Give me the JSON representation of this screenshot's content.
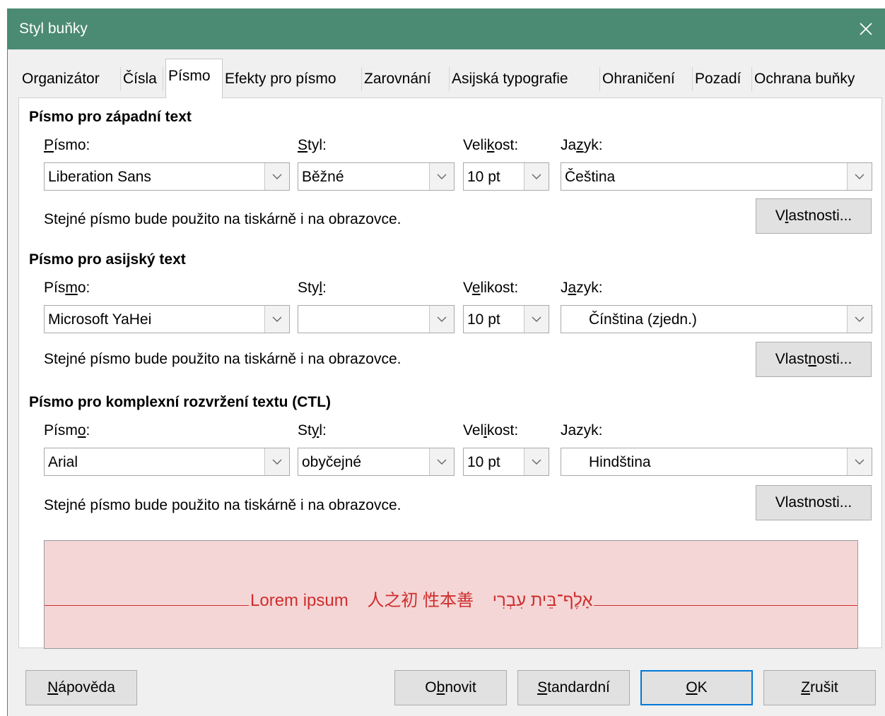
{
  "window": {
    "title": "Styl buňky"
  },
  "tabs": [
    "Organizátor",
    "Čísla",
    "Písmo",
    "Efekty pro písmo",
    "Zarovnání",
    "Asijská typografie",
    "Ohraničení",
    "Pozadí",
    "Ochrana buňky"
  ],
  "active_tab": "Písmo",
  "western": {
    "title": "Písmo pro západní text",
    "font_label": {
      "pre": "",
      "key": "P",
      "post": "ísmo:"
    },
    "style_label": {
      "pre": "",
      "key": "S",
      "post": "tyl:"
    },
    "size_label": {
      "pre": "Veli",
      "key": "k",
      "post": "ost:"
    },
    "lang_label": {
      "pre": "Ja",
      "key": "z",
      "post": "yk:"
    },
    "font_value": "Liberation Sans",
    "style_value": "Běžné",
    "size_value": "10 pt",
    "lang_value": "Čeština",
    "info": "Stejné písmo bude použito na tiskárně i na obrazovce.",
    "props": {
      "pre": "V",
      "key": "l",
      "post": "astnosti..."
    }
  },
  "asian": {
    "title": "Písmo pro asijský text",
    "font_label": {
      "pre": "Pís",
      "key": "m",
      "post": "o:"
    },
    "style_label": {
      "pre": "Sty",
      "key": "l",
      "post": ":"
    },
    "size_label": {
      "pre": "V",
      "key": "e",
      "post": "likost:"
    },
    "lang_label": {
      "pre": "J",
      "key": "a",
      "post": "zyk:"
    },
    "font_value": "Microsoft YaHei",
    "style_value": "",
    "size_value": "10 pt",
    "lang_value": "Čínština (zjedn.)",
    "info": "Stejné písmo bude použito na tiskárně i na obrazovce.",
    "props": {
      "pre": "Vlast",
      "key": "n",
      "post": "osti..."
    }
  },
  "ctl": {
    "title": "Písmo pro komplexní rozvržení textu (CTL)",
    "font_label": {
      "pre": "Písm",
      "key": "o",
      "post": ":"
    },
    "style_label": {
      "pre": "St",
      "key": "y",
      "post": "l:"
    },
    "size_label": {
      "pre": "Vel",
      "key": "i",
      "post": "kost:"
    },
    "lang_label": {
      "pre": "Jazyk:",
      "key": "",
      "post": ""
    },
    "font_value": "Arial",
    "style_value": "obyčejné",
    "size_value": "10 pt",
    "lang_value": "Hindština",
    "info": "Stejné písmo bude použito na tiskárně i na obrazovce.",
    "props": {
      "pre": "Vlastnosti...",
      "key": "",
      "post": ""
    }
  },
  "preview": {
    "western": "Lorem ipsum",
    "asian": "人之初 性本善",
    "ctl": "אָלֶף־בֵּית עִבְרִי"
  },
  "footer": {
    "help": {
      "pre": "",
      "key": "N",
      "post": "ápověda"
    },
    "reset": {
      "pre": "O",
      "key": "b",
      "post": "novit"
    },
    "standard": {
      "pre": "",
      "key": "S",
      "post": "tandardní"
    },
    "ok": {
      "pre": "",
      "key": "O",
      "post": "K"
    },
    "cancel": {
      "pre": "",
      "key": "Z",
      "post": "rušit"
    }
  },
  "colors": {
    "titlebar": "#4b8a73",
    "preview_bg": "#f4d6d6",
    "preview_text": "#cf2e2e",
    "default_button_border": "#0078d7"
  },
  "icons": {
    "close": "close-icon",
    "dropdown": "chevron-down-icon"
  }
}
